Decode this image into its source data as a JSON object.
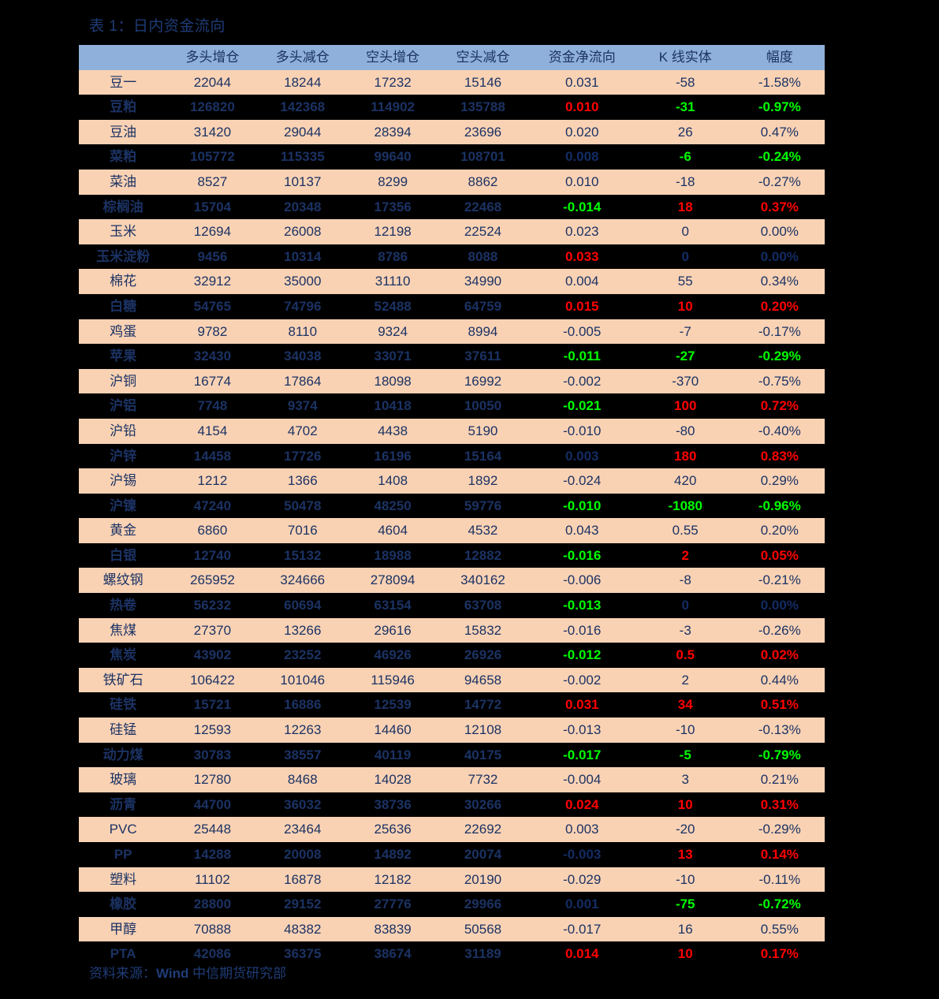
{
  "title": "表 1：日内资金流向",
  "footer": {
    "prefix": "资料来源：",
    "source": "Wind",
    "dept": "中信期货研究部"
  },
  "colors": {
    "header_bg": "#8FB0DA",
    "row_bg_odd": "#F9D2B4",
    "row_bg_even": "#000000",
    "text": "#1B3263",
    "positive": "#FF0000",
    "negative": "#00E000",
    "title": "#1F3C77"
  },
  "table": {
    "columns": [
      {
        "key": "name",
        "label": ""
      },
      {
        "key": "long_add",
        "label": "多头增仓"
      },
      {
        "key": "long_cut",
        "label": "多头减仓"
      },
      {
        "key": "short_add",
        "label": "空头增仓"
      },
      {
        "key": "short_cut",
        "label": "空头减仓"
      },
      {
        "key": "net_flow",
        "label": "资金净流向"
      },
      {
        "key": "k_body",
        "label": "K 线实体"
      },
      {
        "key": "change",
        "label": "幅度"
      }
    ],
    "rows": [
      {
        "name": "豆一",
        "long_add": "22044",
        "long_cut": "18244",
        "short_add": "17232",
        "short_cut": "15146",
        "net_flow": "0.031",
        "net_flow_tone": "pos",
        "k_body": "-58",
        "k_body_tone": "neg",
        "change": "-1.58%",
        "change_tone": "neg"
      },
      {
        "name": "豆粕",
        "long_add": "126820",
        "long_cut": "142368",
        "short_add": "114902",
        "short_cut": "135788",
        "net_flow": "0.010",
        "net_flow_tone": "pos",
        "k_body": "-31",
        "k_body_tone": "neg",
        "change": "-0.97%",
        "change_tone": "neg"
      },
      {
        "name": "豆油",
        "long_add": "31420",
        "long_cut": "29044",
        "short_add": "28394",
        "short_cut": "23696",
        "net_flow": "0.020",
        "net_flow_tone": "pos",
        "k_body": "26",
        "k_body_tone": "pos",
        "change": "0.47%",
        "change_tone": "pos"
      },
      {
        "name": "菜粕",
        "long_add": "105772",
        "long_cut": "115335",
        "short_add": "99640",
        "short_cut": "108701",
        "net_flow": "0.008",
        "net_flow_tone": "neu",
        "k_body": "-6",
        "k_body_tone": "neg",
        "change": "-0.24%",
        "change_tone": "neg"
      },
      {
        "name": "菜油",
        "long_add": "8527",
        "long_cut": "10137",
        "short_add": "8299",
        "short_cut": "8862",
        "net_flow": "0.010",
        "net_flow_tone": "pos",
        "k_body": "-18",
        "k_body_tone": "neg",
        "change": "-0.27%",
        "change_tone": "neg"
      },
      {
        "name": "棕榈油",
        "long_add": "15704",
        "long_cut": "20348",
        "short_add": "17356",
        "short_cut": "22468",
        "net_flow": "-0.014",
        "net_flow_tone": "neg",
        "k_body": "18",
        "k_body_tone": "pos",
        "change": "0.37%",
        "change_tone": "pos"
      },
      {
        "name": "玉米",
        "long_add": "12694",
        "long_cut": "26008",
        "short_add": "12198",
        "short_cut": "22524",
        "net_flow": "0.023",
        "net_flow_tone": "pos",
        "k_body": "0",
        "k_body_tone": "neu",
        "change": "0.00%",
        "change_tone": "neu"
      },
      {
        "name": "玉米淀粉",
        "long_add": "9456",
        "long_cut": "10314",
        "short_add": "8786",
        "short_cut": "8088",
        "net_flow": "0.033",
        "net_flow_tone": "pos",
        "k_body": "0",
        "k_body_tone": "neu",
        "change": "0.00%",
        "change_tone": "neu"
      },
      {
        "name": "棉花",
        "long_add": "32912",
        "long_cut": "35000",
        "short_add": "31110",
        "short_cut": "34990",
        "net_flow": "0.004",
        "net_flow_tone": "neu",
        "k_body": "55",
        "k_body_tone": "pos",
        "change": "0.34%",
        "change_tone": "pos"
      },
      {
        "name": "白糖",
        "long_add": "54765",
        "long_cut": "74796",
        "short_add": "52488",
        "short_cut": "64759",
        "net_flow": "0.015",
        "net_flow_tone": "pos",
        "k_body": "10",
        "k_body_tone": "pos",
        "change": "0.20%",
        "change_tone": "pos"
      },
      {
        "name": "鸡蛋",
        "long_add": "9782",
        "long_cut": "8110",
        "short_add": "9324",
        "short_cut": "8994",
        "net_flow": "-0.005",
        "net_flow_tone": "neu",
        "k_body": "-7",
        "k_body_tone": "neg",
        "change": "-0.17%",
        "change_tone": "neg"
      },
      {
        "name": "苹果",
        "long_add": "32430",
        "long_cut": "34038",
        "short_add": "33071",
        "short_cut": "37611",
        "net_flow": "-0.011",
        "net_flow_tone": "neg",
        "k_body": "-27",
        "k_body_tone": "neg",
        "change": "-0.29%",
        "change_tone": "neg"
      },
      {
        "name": "沪铜",
        "long_add": "16774",
        "long_cut": "17864",
        "short_add": "18098",
        "short_cut": "16992",
        "net_flow": "-0.002",
        "net_flow_tone": "neu",
        "k_body": "-370",
        "k_body_tone": "neg",
        "change": "-0.75%",
        "change_tone": "neg"
      },
      {
        "name": "沪铝",
        "long_add": "7748",
        "long_cut": "9374",
        "short_add": "10418",
        "short_cut": "10050",
        "net_flow": "-0.021",
        "net_flow_tone": "neg",
        "k_body": "100",
        "k_body_tone": "pos",
        "change": "0.72%",
        "change_tone": "pos"
      },
      {
        "name": "沪铅",
        "long_add": "4154",
        "long_cut": "4702",
        "short_add": "4438",
        "short_cut": "5190",
        "net_flow": "-0.010",
        "net_flow_tone": "neg",
        "k_body": "-80",
        "k_body_tone": "neg",
        "change": "-0.40%",
        "change_tone": "neg"
      },
      {
        "name": "沪锌",
        "long_add": "14458",
        "long_cut": "17726",
        "short_add": "16196",
        "short_cut": "15164",
        "net_flow": "0.003",
        "net_flow_tone": "neu",
        "k_body": "180",
        "k_body_tone": "pos",
        "change": "0.83%",
        "change_tone": "pos"
      },
      {
        "name": "沪锡",
        "long_add": "1212",
        "long_cut": "1366",
        "short_add": "1408",
        "short_cut": "1892",
        "net_flow": "-0.024",
        "net_flow_tone": "neg",
        "k_body": "420",
        "k_body_tone": "pos",
        "change": "0.29%",
        "change_tone": "pos"
      },
      {
        "name": "沪镍",
        "long_add": "47240",
        "long_cut": "50478",
        "short_add": "48250",
        "short_cut": "59776",
        "net_flow": "-0.010",
        "net_flow_tone": "neg",
        "k_body": "-1080",
        "k_body_tone": "neg",
        "change": "-0.96%",
        "change_tone": "neg"
      },
      {
        "name": "黄金",
        "long_add": "6860",
        "long_cut": "7016",
        "short_add": "4604",
        "short_cut": "4532",
        "net_flow": "0.043",
        "net_flow_tone": "pos",
        "k_body": "0.55",
        "k_body_tone": "pos",
        "change": "0.20%",
        "change_tone": "pos"
      },
      {
        "name": "白银",
        "long_add": "12740",
        "long_cut": "15132",
        "short_add": "18988",
        "short_cut": "12882",
        "net_flow": "-0.016",
        "net_flow_tone": "neg",
        "k_body": "2",
        "k_body_tone": "pos",
        "change": "0.05%",
        "change_tone": "pos"
      },
      {
        "name": "螺纹钢",
        "long_add": "265952",
        "long_cut": "324666",
        "short_add": "278094",
        "short_cut": "340162",
        "net_flow": "-0.006",
        "net_flow_tone": "neu",
        "k_body": "-8",
        "k_body_tone": "neg",
        "change": "-0.21%",
        "change_tone": "neg"
      },
      {
        "name": "热卷",
        "long_add": "56232",
        "long_cut": "60694",
        "short_add": "63154",
        "short_cut": "63708",
        "net_flow": "-0.013",
        "net_flow_tone": "neg",
        "k_body": "0",
        "k_body_tone": "neu",
        "change": "0.00%",
        "change_tone": "neu"
      },
      {
        "name": "焦煤",
        "long_add": "27370",
        "long_cut": "13266",
        "short_add": "29616",
        "short_cut": "15832",
        "net_flow": "-0.016",
        "net_flow_tone": "neg",
        "k_body": "-3",
        "k_body_tone": "neg",
        "change": "-0.26%",
        "change_tone": "neg"
      },
      {
        "name": "焦炭",
        "long_add": "43902",
        "long_cut": "23252",
        "short_add": "46926",
        "short_cut": "26926",
        "net_flow": "-0.012",
        "net_flow_tone": "neg",
        "k_body": "0.5",
        "k_body_tone": "pos",
        "change": "0.02%",
        "change_tone": "pos"
      },
      {
        "name": "铁矿石",
        "long_add": "106422",
        "long_cut": "101046",
        "short_add": "115946",
        "short_cut": "94658",
        "net_flow": "-0.002",
        "net_flow_tone": "neu",
        "k_body": "2",
        "k_body_tone": "pos",
        "change": "0.44%",
        "change_tone": "pos"
      },
      {
        "name": "硅铁",
        "long_add": "15721",
        "long_cut": "16886",
        "short_add": "12539",
        "short_cut": "14772",
        "net_flow": "0.031",
        "net_flow_tone": "pos",
        "k_body": "34",
        "k_body_tone": "pos",
        "change": "0.51%",
        "change_tone": "pos"
      },
      {
        "name": "硅锰",
        "long_add": "12593",
        "long_cut": "12263",
        "short_add": "14460",
        "short_cut": "12108",
        "net_flow": "-0.013",
        "net_flow_tone": "neg",
        "k_body": "-10",
        "k_body_tone": "neg",
        "change": "-0.13%",
        "change_tone": "neg"
      },
      {
        "name": "动力煤",
        "long_add": "30783",
        "long_cut": "38557",
        "short_add": "40119",
        "short_cut": "40175",
        "net_flow": "-0.017",
        "net_flow_tone": "neg",
        "k_body": "-5",
        "k_body_tone": "neg",
        "change": "-0.79%",
        "change_tone": "neg"
      },
      {
        "name": "玻璃",
        "long_add": "12780",
        "long_cut": "8468",
        "short_add": "14028",
        "short_cut": "7732",
        "net_flow": "-0.004",
        "net_flow_tone": "neu",
        "k_body": "3",
        "k_body_tone": "pos",
        "change": "0.21%",
        "change_tone": "pos"
      },
      {
        "name": "沥青",
        "long_add": "44700",
        "long_cut": "36032",
        "short_add": "38736",
        "short_cut": "30266",
        "net_flow": "0.024",
        "net_flow_tone": "pos",
        "k_body": "10",
        "k_body_tone": "pos",
        "change": "0.31%",
        "change_tone": "pos"
      },
      {
        "name": "PVC",
        "long_add": "25448",
        "long_cut": "23464",
        "short_add": "25636",
        "short_cut": "22692",
        "net_flow": "0.003",
        "net_flow_tone": "neu",
        "k_body": "-20",
        "k_body_tone": "neg",
        "change": "-0.29%",
        "change_tone": "neg"
      },
      {
        "name": "PP",
        "long_add": "14288",
        "long_cut": "20008",
        "short_add": "14892",
        "short_cut": "20074",
        "net_flow": "-0.003",
        "net_flow_tone": "neu",
        "k_body": "13",
        "k_body_tone": "pos",
        "change": "0.14%",
        "change_tone": "pos"
      },
      {
        "name": "塑料",
        "long_add": "11102",
        "long_cut": "16878",
        "short_add": "12182",
        "short_cut": "20190",
        "net_flow": "-0.029",
        "net_flow_tone": "neg",
        "k_body": "-10",
        "k_body_tone": "neg",
        "change": "-0.11%",
        "change_tone": "neg"
      },
      {
        "name": "橡胶",
        "long_add": "28800",
        "long_cut": "29152",
        "short_add": "27776",
        "short_cut": "29966",
        "net_flow": "0.001",
        "net_flow_tone": "neu",
        "k_body": "-75",
        "k_body_tone": "neg",
        "change": "-0.72%",
        "change_tone": "neg"
      },
      {
        "name": "甲醇",
        "long_add": "70888",
        "long_cut": "48382",
        "short_add": "83839",
        "short_cut": "50568",
        "net_flow": "-0.017",
        "net_flow_tone": "neg",
        "k_body": "16",
        "k_body_tone": "pos",
        "change": "0.55%",
        "change_tone": "pos"
      },
      {
        "name": "PTA",
        "long_add": "42086",
        "long_cut": "36375",
        "short_add": "38674",
        "short_cut": "31189",
        "net_flow": "0.014",
        "net_flow_tone": "pos",
        "k_body": "10",
        "k_body_tone": "pos",
        "change": "0.17%",
        "change_tone": "pos"
      }
    ]
  }
}
